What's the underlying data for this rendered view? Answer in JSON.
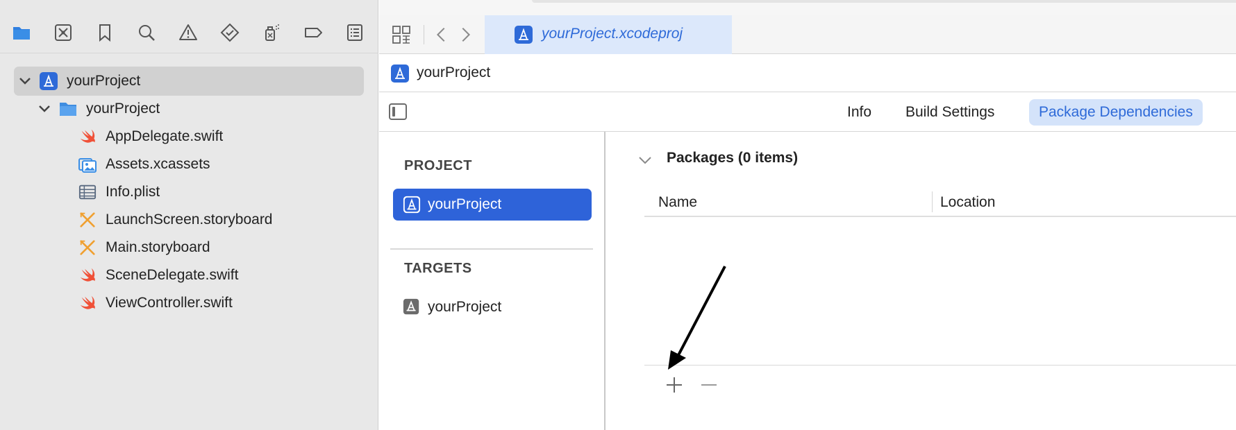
{
  "navigator": {
    "toolbar_icons": [
      "folder-icon",
      "source-control-icon",
      "bookmark-icon",
      "search-icon",
      "warning-icon",
      "test-diamond-icon",
      "debug-spray-icon",
      "breakpoint-tag-icon",
      "report-list-icon"
    ],
    "tree": [
      {
        "label": "yourProject",
        "icon": "app-project-icon",
        "expanded": true,
        "selected": true
      },
      {
        "label": "yourProject",
        "icon": "blue-folder-icon",
        "expanded": true,
        "selected": false
      },
      {
        "label": "AppDelegate.swift",
        "icon": "swift-file-icon"
      },
      {
        "label": "Assets.xcassets",
        "icon": "asset-catalog-icon"
      },
      {
        "label": "Info.plist",
        "icon": "plist-table-icon"
      },
      {
        "label": "LaunchScreen.storyboard",
        "icon": "storyboard-icon"
      },
      {
        "label": "Main.storyboard",
        "icon": "storyboard-icon"
      },
      {
        "label": "SceneDelegate.swift",
        "icon": "swift-file-icon"
      },
      {
        "label": "ViewController.swift",
        "icon": "swift-file-icon"
      }
    ]
  },
  "editor": {
    "tab": {
      "label": "yourProject.xcodeproj",
      "icon": "app-project-icon"
    },
    "jumpbar": {
      "label": "yourProject"
    },
    "segments": [
      {
        "label": "Info",
        "active": false
      },
      {
        "label": "Build Settings",
        "active": false
      },
      {
        "label": "Package Dependencies",
        "active": true
      }
    ],
    "project_list": {
      "project_header": "PROJECT",
      "project_item": "yourProject",
      "targets_header": "TARGETS",
      "target_item": "yourProject"
    },
    "packages": {
      "title": "Packages (0 items)",
      "columns": [
        "Name",
        "Location"
      ],
      "add_symbol": "+",
      "remove_symbol": "−"
    }
  },
  "colors": {
    "accent": "#2e63d9",
    "tab_active_bg": "#dce8fb",
    "segment_active_bg": "#d4e3fa",
    "sidebar_bg": "#e8e8e8",
    "swift_orange": "#f05138",
    "storyboard_orange": "#f0a030",
    "folder_blue": "#3a8ee6"
  }
}
